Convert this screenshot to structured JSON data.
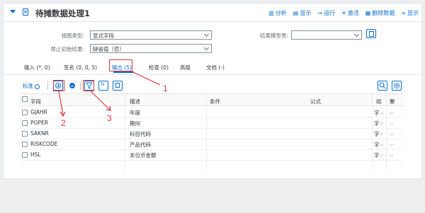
{
  "header": {
    "title": "待摊数据处理1",
    "toolbar": [
      {
        "label": "分析",
        "icon": "bar-chart-icon"
      },
      {
        "label": "显示",
        "icon": "display-icon"
      },
      {
        "label": "运行",
        "icon": "run-arrow-icon"
      },
      {
        "label": "激活",
        "icon": "activate-icon"
      },
      {
        "label": "删除数据",
        "icon": "delete-icon"
      },
      {
        "label": "显示",
        "icon": "glasses-icon"
      }
    ]
  },
  "form": {
    "view_type_label": "视图类型:",
    "view_type_value": "显式字段",
    "disable_init_label": "禁止初始结果:",
    "disable_init_value": "缺省值（否）",
    "result_model_label": "结果模型表:",
    "result_model_value": ""
  },
  "tabs": [
    {
      "label": "输入 (*, 0)"
    },
    {
      "label": "签名 (0, 0, 5)"
    },
    {
      "label": "输出 (5)",
      "active": true
    },
    {
      "label": "检查 (0)"
    },
    {
      "label": "高级"
    },
    {
      "label": "文档 (-)"
    }
  ],
  "grid_toolbar": {
    "variant_label": "标准"
  },
  "table": {
    "columns": [
      "字段",
      "描述",
      "条件",
      "公式",
      "组",
      "聚"
    ],
    "rows": [
      {
        "field": "GJAHR",
        "desc": "年度",
        "group": "字",
        "agg": ""
      },
      {
        "field": "POPER",
        "desc": "期间",
        "group": "字",
        "agg": ""
      },
      {
        "field": "SAKNR",
        "desc": "科目代码",
        "group": "字",
        "agg": ""
      },
      {
        "field": "RISKCODE",
        "desc": "产品代码",
        "group": "字",
        "agg": ""
      },
      {
        "field": "HSL",
        "desc": "本位币金额",
        "group": "字",
        "agg": ""
      }
    ]
  },
  "annotations": {
    "n1": "1",
    "n2": "2",
    "n3": "3",
    "color": "#e0393e"
  },
  "colors": {
    "accent": "#0a6ed1",
    "annotation": "#e0393e"
  }
}
